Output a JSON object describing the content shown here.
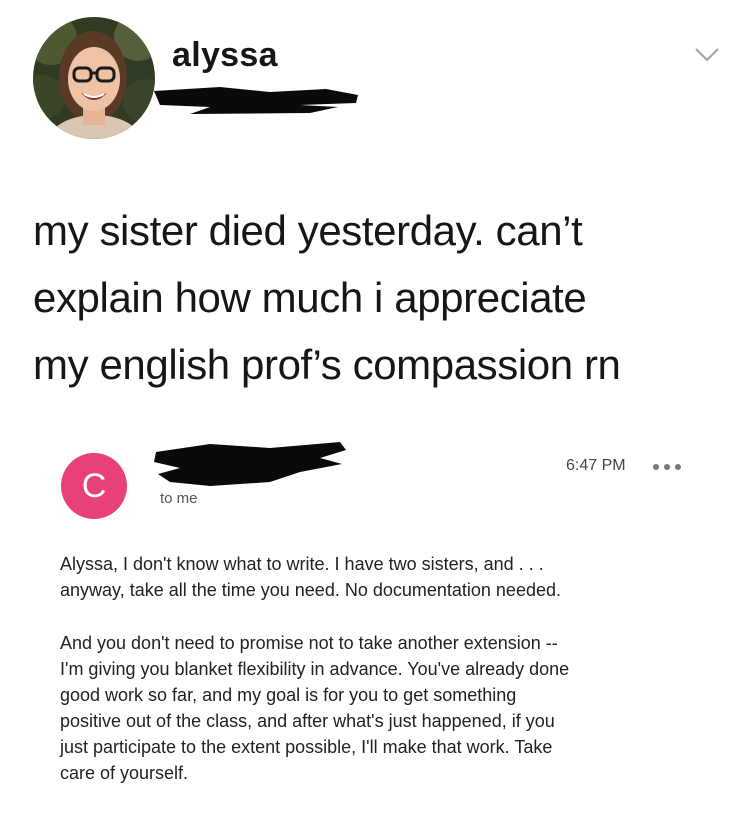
{
  "tweet": {
    "author_name": "alyssa",
    "text_lines": [
      "my sister died yesterday. can’t",
      "explain how much i appreciate",
      "my english prof’s compassion rn"
    ],
    "menu_icon": "chevron-down-icon"
  },
  "email": {
    "sender_initial": "C",
    "recipient": "to me",
    "time": "6:47 PM",
    "more_icon": "more-dots-icon",
    "paragraphs": [
      "Alyssa, I don't know what to write. I have two sisters, and . . .\nanyway, take all the time you need. No documentation needed.",
      "And you don't need to promise not to take another extension --\nI'm giving you blanket flexibility in advance. You've already done\ngood work so far, and my goal is for you to get something\npositive out of the class, and after what's just happened, if you\njust participate to the extent possible, I'll make that work. Take\ncare of yourself."
    ],
    "avatar_color": "#e8407a"
  }
}
